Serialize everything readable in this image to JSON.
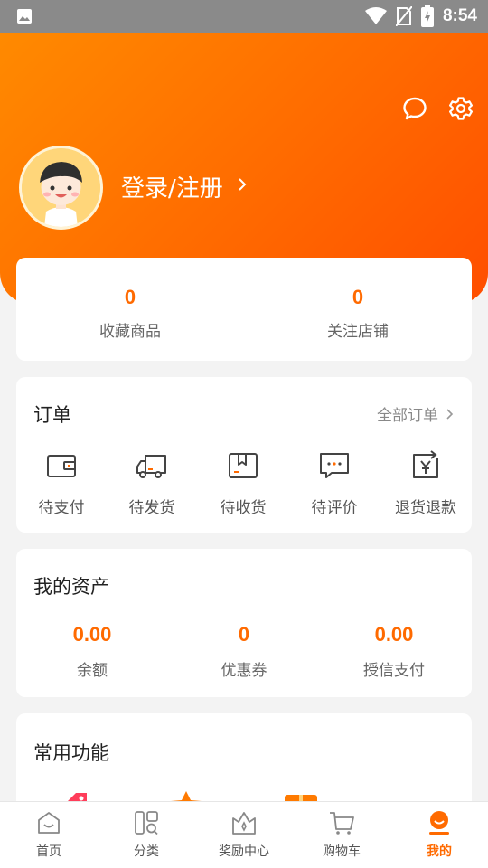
{
  "status_bar": {
    "time": "8:54"
  },
  "profile": {
    "login_label": "登录/注册"
  },
  "favorites": [
    {
      "count": "0",
      "label": "收藏商品"
    },
    {
      "count": "0",
      "label": "关注店铺"
    }
  ],
  "orders": {
    "title": "订单",
    "all_label": "全部订单",
    "items": [
      {
        "label": "待支付",
        "icon": "wallet-icon"
      },
      {
        "label": "待发货",
        "icon": "truck-icon"
      },
      {
        "label": "待收货",
        "icon": "box-icon"
      },
      {
        "label": "待评价",
        "icon": "comment-icon"
      },
      {
        "label": "退货退款",
        "icon": "refund-icon"
      }
    ]
  },
  "assets": {
    "title": "我的资产",
    "items": [
      {
        "value": "0.00",
        "label": "余额"
      },
      {
        "value": "0",
        "label": "优惠券"
      },
      {
        "value": "0.00",
        "label": "授信支付"
      }
    ]
  },
  "functions": {
    "title": "常用功能"
  },
  "tabbar": {
    "items": [
      {
        "label": "首页",
        "icon": "home-icon"
      },
      {
        "label": "分类",
        "icon": "category-icon"
      },
      {
        "label": "奖励中心",
        "icon": "reward-icon"
      },
      {
        "label": "购物车",
        "icon": "cart-icon"
      },
      {
        "label": "我的",
        "icon": "profile-icon"
      }
    ],
    "active_index": 4
  },
  "colors": {
    "accent": "#ff6a00",
    "hero_start": "#ff8a00",
    "hero_end": "#ff4e00"
  }
}
